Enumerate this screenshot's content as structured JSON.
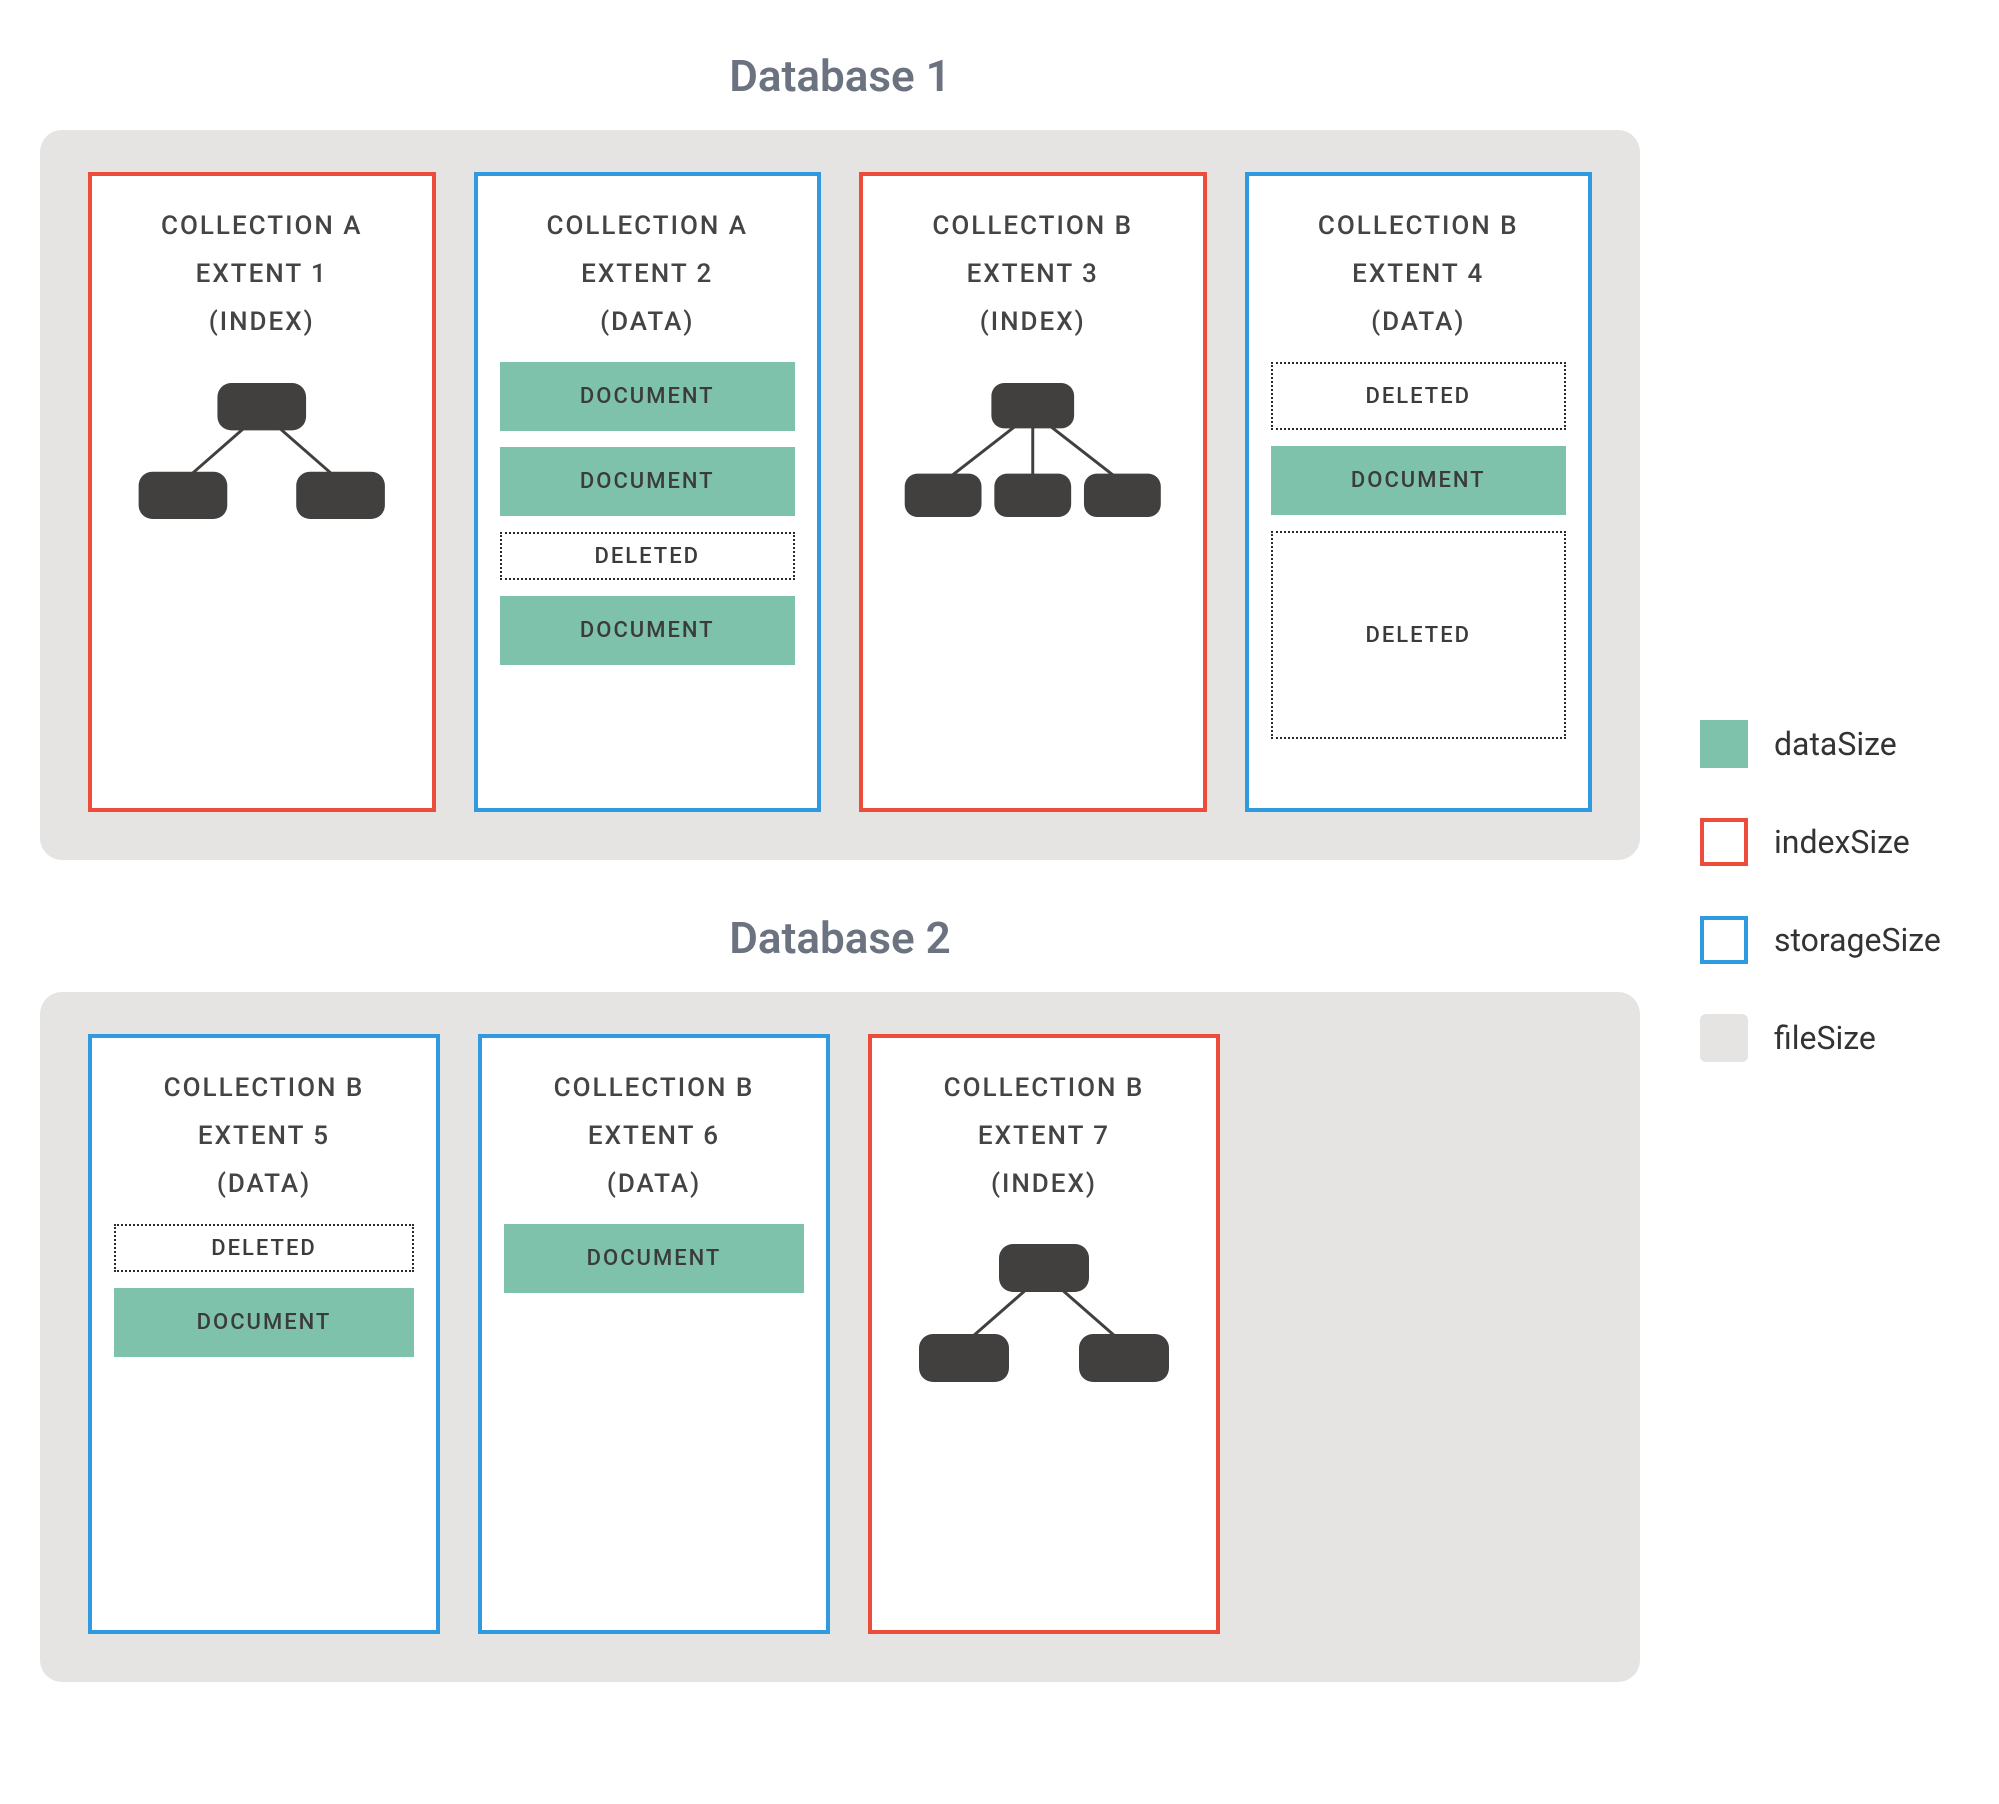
{
  "databases": [
    {
      "title": "Database 1",
      "extents": [
        {
          "header_line1": "COLLECTION A",
          "header_line2": "EXTENT 1",
          "header_line3": "(INDEX)",
          "border": "red",
          "body_type": "tree2"
        },
        {
          "header_line1": "COLLECTION A",
          "header_line2": "EXTENT 2",
          "header_line3": "(DATA)",
          "border": "blue",
          "body_type": "docs",
          "items": [
            {
              "kind": "doc",
              "label": "DOCUMENT"
            },
            {
              "kind": "doc",
              "label": "DOCUMENT"
            },
            {
              "kind": "deleted",
              "size": "small",
              "label": "DELETED"
            },
            {
              "kind": "doc",
              "label": "DOCUMENT"
            }
          ]
        },
        {
          "header_line1": "COLLECTION B",
          "header_line2": "EXTENT 3",
          "header_line3": "(INDEX)",
          "border": "red",
          "body_type": "tree3"
        },
        {
          "header_line1": "COLLECTION B",
          "header_line2": "EXTENT 4",
          "header_line3": "(DATA)",
          "border": "blue",
          "body_type": "docs",
          "items": [
            {
              "kind": "deleted",
              "size": "medium",
              "label": "DELETED"
            },
            {
              "kind": "doc",
              "label": "DOCUMENT"
            },
            {
              "kind": "deleted",
              "size": "large",
              "label": "DELETED"
            }
          ]
        }
      ]
    },
    {
      "title": "Database 2",
      "extents": [
        {
          "header_line1": "COLLECTION B",
          "header_line2": "EXTENT 5",
          "header_line3": "(DATA)",
          "border": "blue",
          "body_type": "docs",
          "items": [
            {
              "kind": "deleted",
              "size": "small",
              "label": "DELETED"
            },
            {
              "kind": "doc",
              "label": "DOCUMENT"
            }
          ]
        },
        {
          "header_line1": "COLLECTION B",
          "header_line2": "EXTENT 6",
          "header_line3": "(DATA)",
          "border": "blue",
          "body_type": "docs",
          "items": [
            {
              "kind": "doc",
              "label": "DOCUMENT"
            }
          ]
        },
        {
          "header_line1": "COLLECTION B",
          "header_line2": "EXTENT 7",
          "header_line3": "(INDEX)",
          "border": "red",
          "body_type": "tree2"
        }
      ]
    }
  ],
  "legend": [
    {
      "swatch": "filled-green",
      "label": "dataSize"
    },
    {
      "swatch": "outline-red",
      "label": "indexSize"
    },
    {
      "swatch": "outline-blue",
      "label": "storageSize"
    },
    {
      "swatch": "filled-grey",
      "label": "fileSize"
    }
  ],
  "colors": {
    "green": "#7ec2ac",
    "red": "#ed4c3b",
    "blue": "#2f9ae0",
    "grey": "#e5e4e2",
    "node": "#423f3f"
  }
}
